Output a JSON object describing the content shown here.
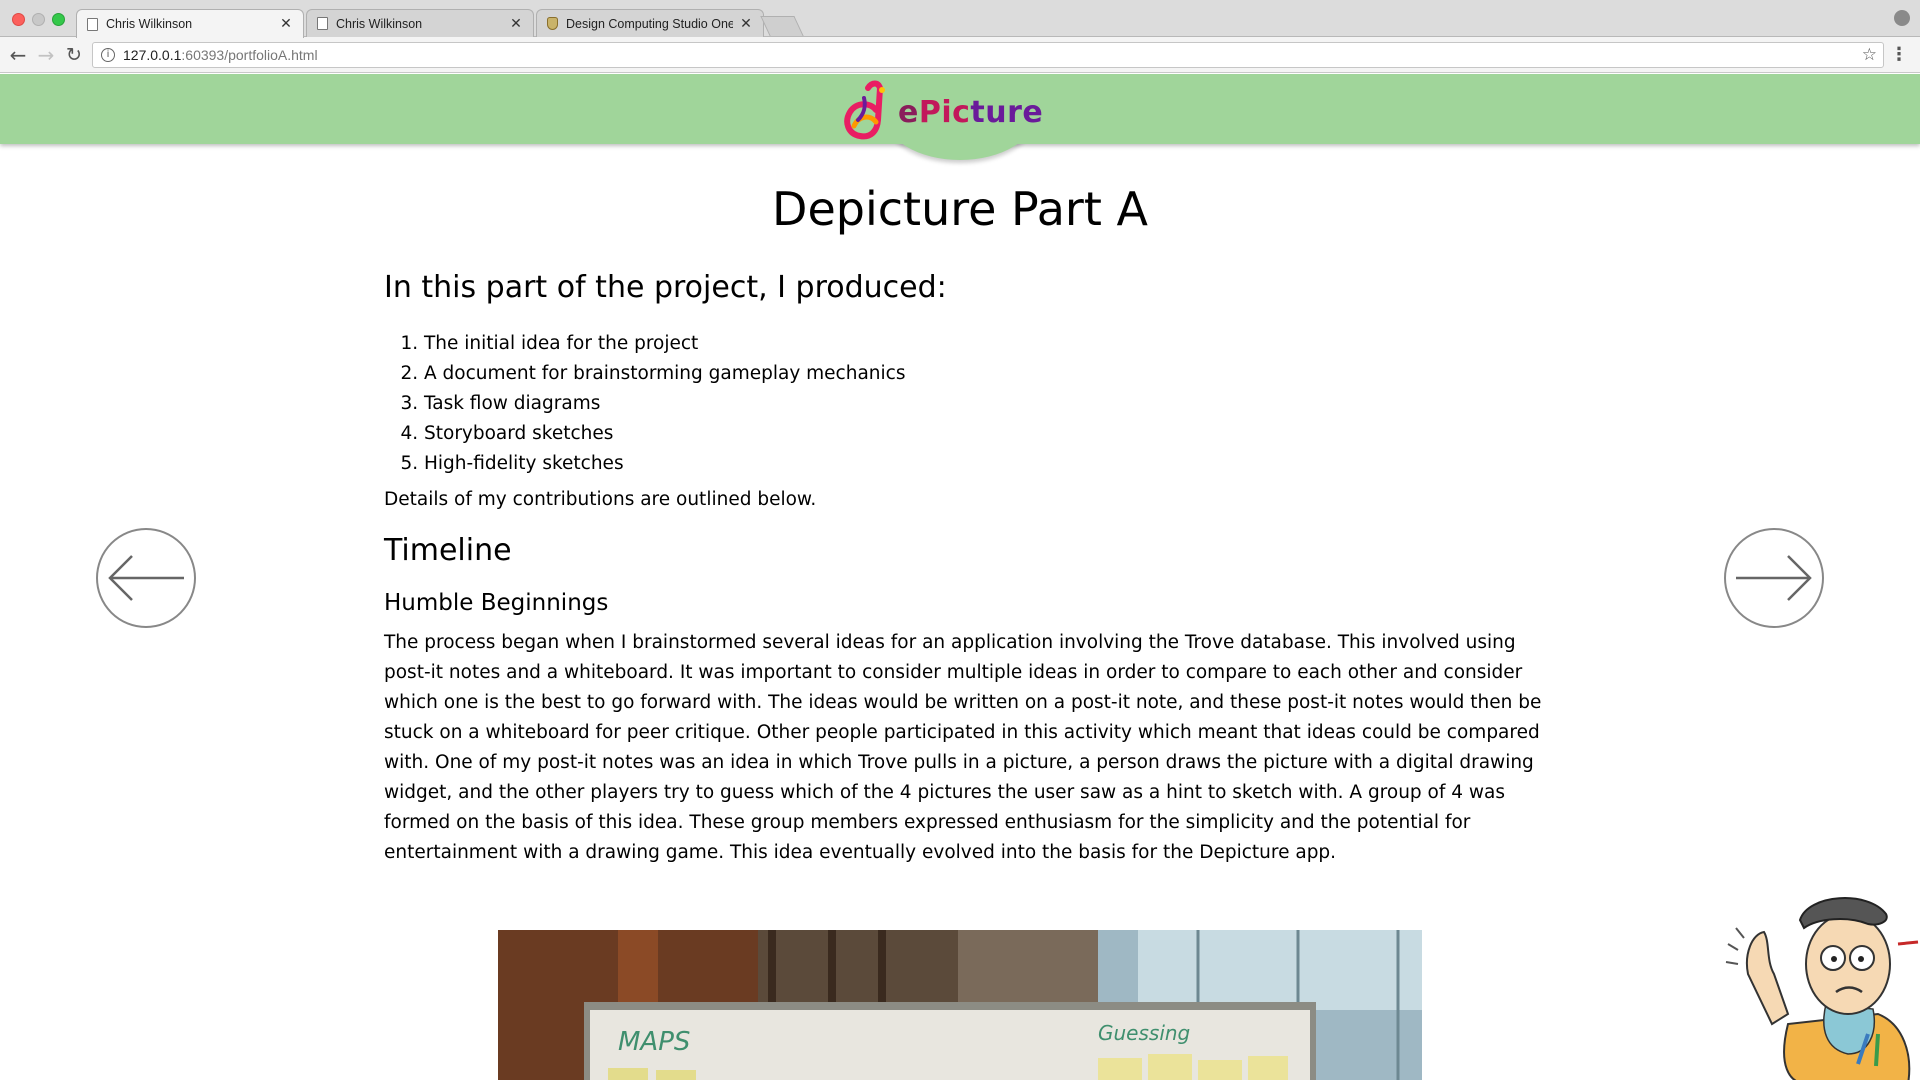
{
  "browser": {
    "tabs": [
      {
        "title": "Chris Wilkinson",
        "active": true
      },
      {
        "title": "Chris Wilkinson",
        "active": false
      },
      {
        "title": "Design Computing Studio One",
        "active": false
      }
    ],
    "url_host": "127.0.0.1",
    "url_path": ":60393/portfolioA.html"
  },
  "header": {
    "logo_text": "ePicture",
    "logo_colors": {
      "bg": "#a0d59a",
      "mark_pink": "#e91e63",
      "mark_orange": "#ff9800",
      "mark_purple": "#6a1b9a"
    }
  },
  "page": {
    "title": "Depicture Part A",
    "intro_heading": "In this part of the project, I produced:",
    "produced_items": [
      "The initial idea for the project",
      "A document for brainstorming gameplay mechanics",
      "Task flow diagrams",
      "Storyboard sketches",
      "High-fidelity sketches"
    ],
    "details_text": "Details of my contributions are outlined below.",
    "timeline_heading": "Timeline",
    "section_heading": "Humble Beginnings",
    "section_body": "The process began when I brainstormed several ideas for an application involving the Trove database. This involved using post-it notes and a whiteboard. It was important to consider multiple ideas in order to compare to each other and consider which one is the best to go forward with. The ideas would be written on a post-it note, and these post-it notes would then be stuck on a whiteboard for peer critique. Other people participated in this activity which meant that ideas could be compared with. One of my post-it notes was an idea in which Trove pulls in a picture, a person draws the picture with a digital drawing widget, and the other players try to guess which of the 4 pictures the user saw as a hint to sketch with. A group of 4 was formed on the basis of this idea. These group members expressed enthusiasm for the simplicity and the potential for entertainment with a drawing game. This idea eventually evolved into the basis for the Depicture app.",
    "photo_whiteboard_words": [
      "MAPS",
      "Guessing"
    ]
  },
  "nav": {
    "prev_icon": "arrow-left-icon",
    "next_icon": "arrow-right-icon"
  }
}
